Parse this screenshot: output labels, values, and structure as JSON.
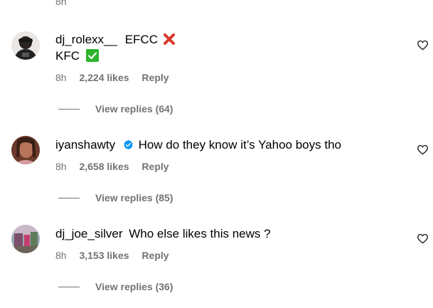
{
  "top": {
    "time": "8h"
  },
  "comments": [
    {
      "username": "dj_rolexx__",
      "text_line1": "EFCC",
      "text_line2": "KFC",
      "time": "8h",
      "likes": "2,224 likes",
      "reply": "Reply",
      "view_replies": "View replies (64)",
      "line1_emoji": "cross-mark-icon",
      "line2_emoji": "check-mark-icon"
    },
    {
      "username": "iyanshawty",
      "verified": true,
      "text": "How do they know it’s Yahoo boys tho",
      "time": "8h",
      "likes": "2,658 likes",
      "reply": "Reply",
      "view_replies": "View replies (85)"
    },
    {
      "username": "dj_joe_silver",
      "text": "Who else likes this news ?",
      "time": "8h",
      "likes": "3,153 likes",
      "reply": "Reply",
      "view_replies": "View replies (36)"
    }
  ],
  "colors": {
    "secondary_text": "#737373",
    "verified_blue": "#0095f6",
    "cross_red": "#d9372b",
    "check_green": "#2cb42c"
  }
}
